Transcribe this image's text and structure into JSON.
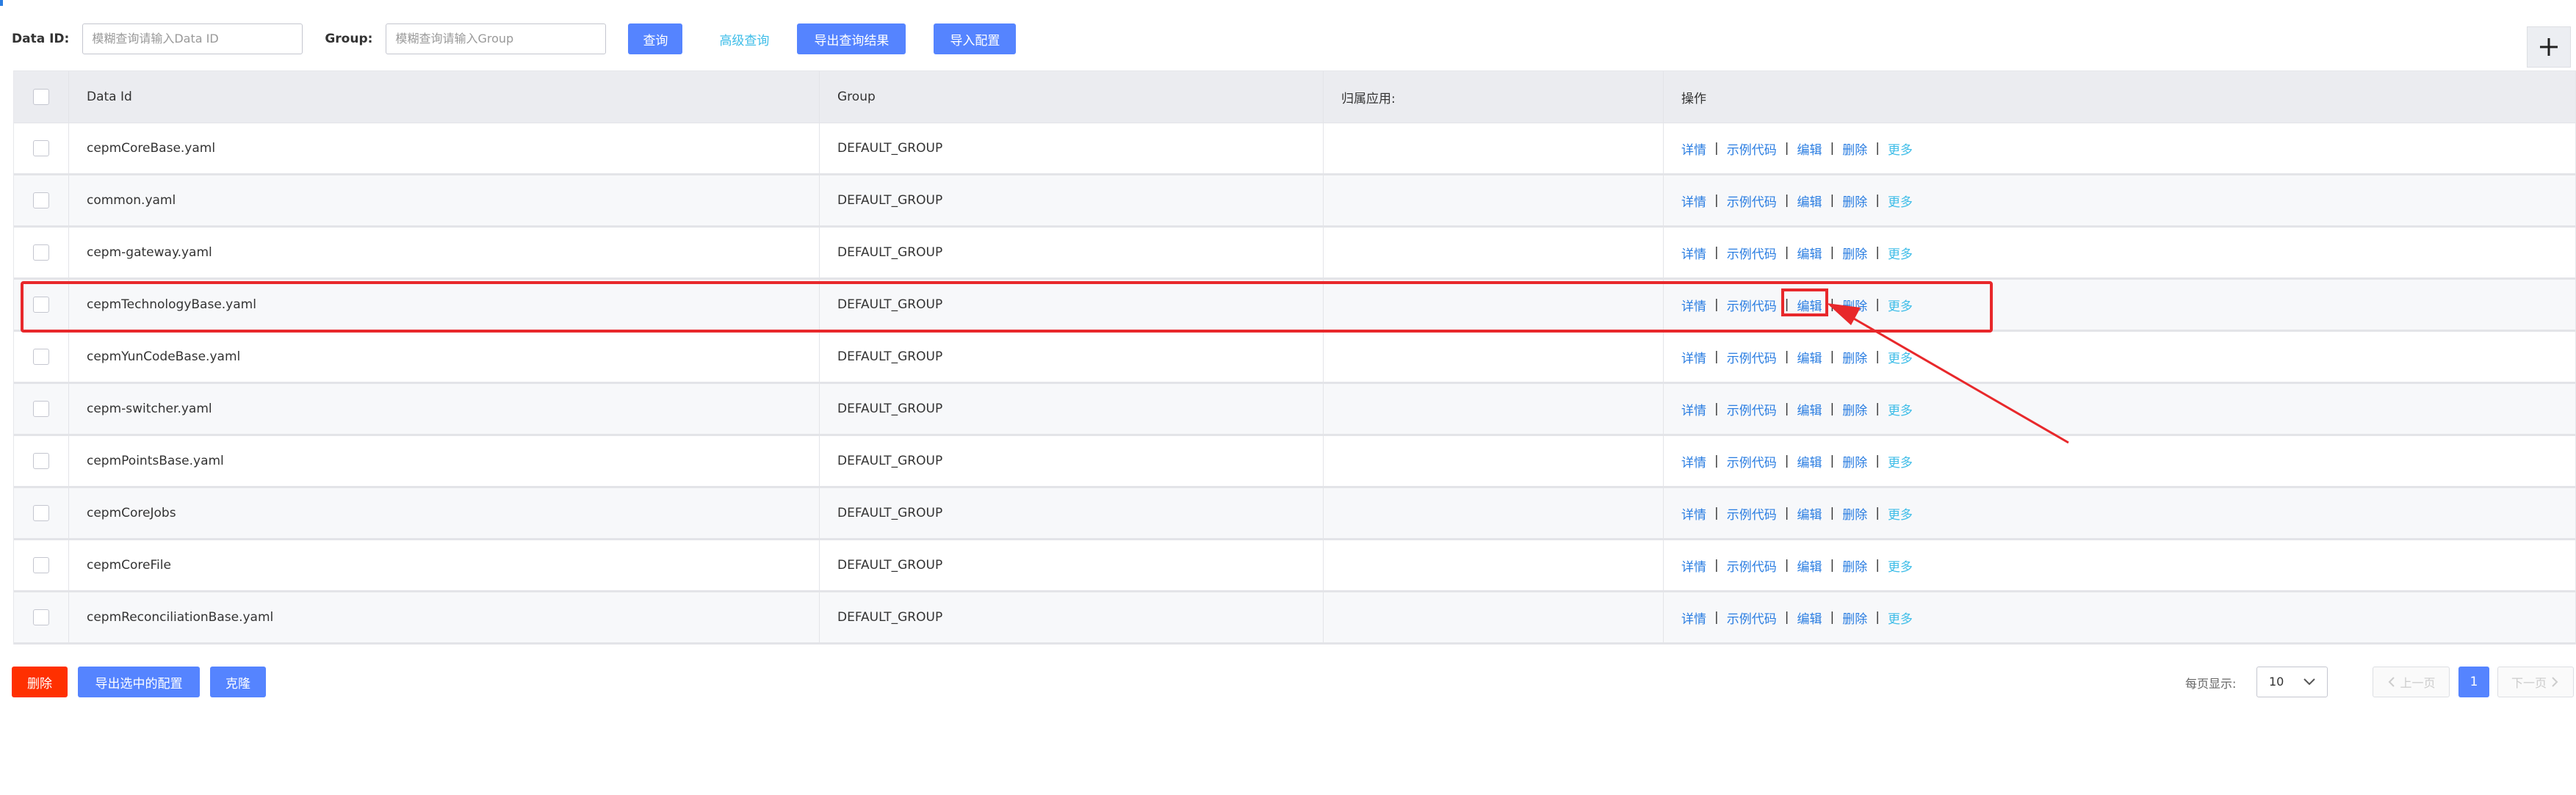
{
  "search": {
    "data_id_label": "Data ID:",
    "data_id_placeholder": "模糊查询请输入Data ID",
    "group_label": "Group:",
    "group_placeholder": "模糊查询请输入Group",
    "query_button": "查询",
    "advanced_query": "高级查询",
    "export_results_button": "导出查询结果",
    "import_config_button": "导入配置"
  },
  "table": {
    "headers": {
      "data_id": "Data Id",
      "group": "Group",
      "app": "归属应用:",
      "actions": "操作"
    },
    "action_labels": {
      "details": "详情",
      "sample_code": "示例代码",
      "edit": "编辑",
      "delete": "删除",
      "more": "更多"
    },
    "separator": "|",
    "rows": [
      {
        "data_id": "cepmCoreBase.yaml",
        "group": "DEFAULT_GROUP",
        "app": ""
      },
      {
        "data_id": "common.yaml",
        "group": "DEFAULT_GROUP",
        "app": ""
      },
      {
        "data_id": "cepm-gateway.yaml",
        "group": "DEFAULT_GROUP",
        "app": ""
      },
      {
        "data_id": "cepmTechnologyBase.yaml",
        "group": "DEFAULT_GROUP",
        "app": ""
      },
      {
        "data_id": "cepmYunCodeBase.yaml",
        "group": "DEFAULT_GROUP",
        "app": ""
      },
      {
        "data_id": "cepm-switcher.yaml",
        "group": "DEFAULT_GROUP",
        "app": ""
      },
      {
        "data_id": "cepmPointsBase.yaml",
        "group": "DEFAULT_GROUP",
        "app": ""
      },
      {
        "data_id": "cepmCoreJobs",
        "group": "DEFAULT_GROUP",
        "app": ""
      },
      {
        "data_id": "cepmCoreFile",
        "group": "DEFAULT_GROUP",
        "app": ""
      },
      {
        "data_id": "cepmReconciliationBase.yaml",
        "group": "DEFAULT_GROUP",
        "app": ""
      }
    ]
  },
  "footer": {
    "delete_button": "删除",
    "export_selected_button": "导出选中的配置",
    "clone_button": "克隆",
    "page_size_label": "每页显示:",
    "page_size_value": "10",
    "prev_page": "上一页",
    "current_page": "1",
    "next_page": "下一页"
  },
  "icons": {
    "add": "plus-icon",
    "select": "chevron-down-icon",
    "prev": "chevron-left-icon",
    "next": "chevron-right-icon"
  },
  "colors": {
    "primary": "#5584ff",
    "link": "#2a7de1",
    "more_link": "#3ebde8",
    "danger": "#ff3000",
    "annotation": "#e8282b"
  }
}
